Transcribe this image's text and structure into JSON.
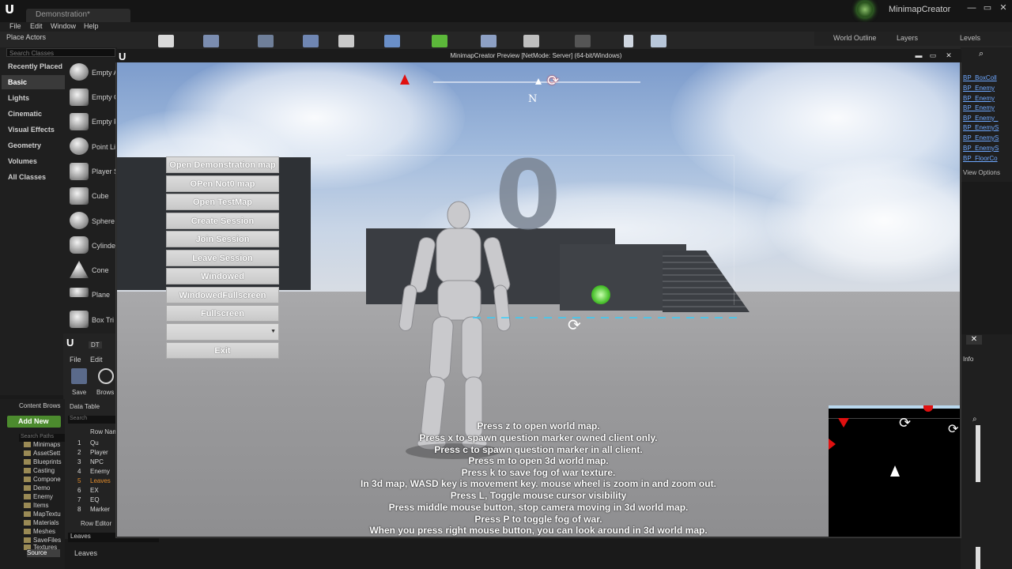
{
  "editor": {
    "doc_tab": "Demonstration*",
    "project_name": "MinimapCreator",
    "menu": [
      "File",
      "Edit",
      "Window",
      "Help"
    ],
    "place_actors_tab": "Place Actors",
    "right_tabs": [
      "World Outline",
      "Layers",
      "Levels"
    ]
  },
  "place_actors": {
    "search_placeholder": "Search Classes",
    "categories": [
      "Recently Placed",
      "Basic",
      "Lights",
      "Cinematic",
      "Visual Effects",
      "Geometry",
      "Volumes",
      "All Classes"
    ],
    "selected_category": "Basic",
    "items": [
      "Empty A",
      "Empty C",
      "Empty P",
      "Point Li",
      "Player S",
      "Cube",
      "Sphere",
      "Cylinde",
      "Cone",
      "Plane",
      "Box Tri"
    ]
  },
  "data_table_editor": {
    "tab": "DT",
    "menu": [
      "File",
      "Edit"
    ],
    "toolbar": [
      "Save",
      "Brows"
    ],
    "table_tab": "Data Table",
    "search_placeholder": "Search",
    "row_name_header": "Row Nam",
    "rows": [
      {
        "n": "1",
        "v": "Qu"
      },
      {
        "n": "2",
        "v": "Player"
      },
      {
        "n": "3",
        "v": "NPC"
      },
      {
        "n": "4",
        "v": "Enemy"
      },
      {
        "n": "5",
        "v": "Leaves"
      },
      {
        "n": "6",
        "v": "EX"
      },
      {
        "n": "7",
        "v": "EQ"
      },
      {
        "n": "8",
        "v": "Marker"
      }
    ],
    "row_editor": "Row Editor",
    "row_editor_value": "Leaves",
    "leaves_label": "Leaves"
  },
  "content_browser": {
    "tab": "Content Brows",
    "add_new": "Add New",
    "search_placeholder": "Search Paths",
    "folders": [
      "Minimaps",
      "AssetSett",
      "Blueprints",
      "Casting",
      "Compone",
      "Demo",
      "Enemy",
      "Items",
      "MapTextu",
      "Materials",
      "Meshes",
      "SaveFiles",
      "Textures"
    ],
    "selected_folder": "Source"
  },
  "outliner": {
    "items": [
      "BP_BoxColl",
      "BP_Enemy",
      "BP_Enemy",
      "BP_Enemy",
      "BP_Enemy_",
      "BP_EnemyS",
      "BP_EnemyS",
      "BP_EnemyS",
      "BP_FloorCo"
    ],
    "view_options": "View Options",
    "details_info": "Info"
  },
  "preview": {
    "title": "MinimapCreator Preview [NetMode: Server] (64-bit/Windows)",
    "compass_heading": "N",
    "zero_sign": "0"
  },
  "game_menu": {
    "buttons": [
      "Open Demonstration map",
      "OPen Not0 map",
      "Open TestMap",
      "Create Session",
      "Join Session",
      "Leave Session",
      "Windowed",
      "WindowedFullscreen",
      "Fullscreen"
    ],
    "exit": "Exit",
    "resolution_value": ""
  },
  "instructions": [
    "Press z to open world map.",
    "Press x to spawn question marker owned client only.",
    "Press c to spawn question marker in all client.",
    "Press m to open 3d world map.",
    "Press k to save fog of war texture.",
    "In 3d map, WASD key is movement key. mouse wheel is zoom in and zoom out.",
    "Press L, Toggle mouse cursor visibility",
    "Press middle mouse button, stop camera moving in 3d world map.",
    "Press P to toggle fog of war.",
    "When you press right mouse button, you can look around in 3d world map."
  ],
  "colors": {
    "accent_green": "#4c8b2e",
    "marker_red": "#e01010",
    "link_blue": "#6ea8ff",
    "selected_folder_orange": "#e08a2a"
  }
}
